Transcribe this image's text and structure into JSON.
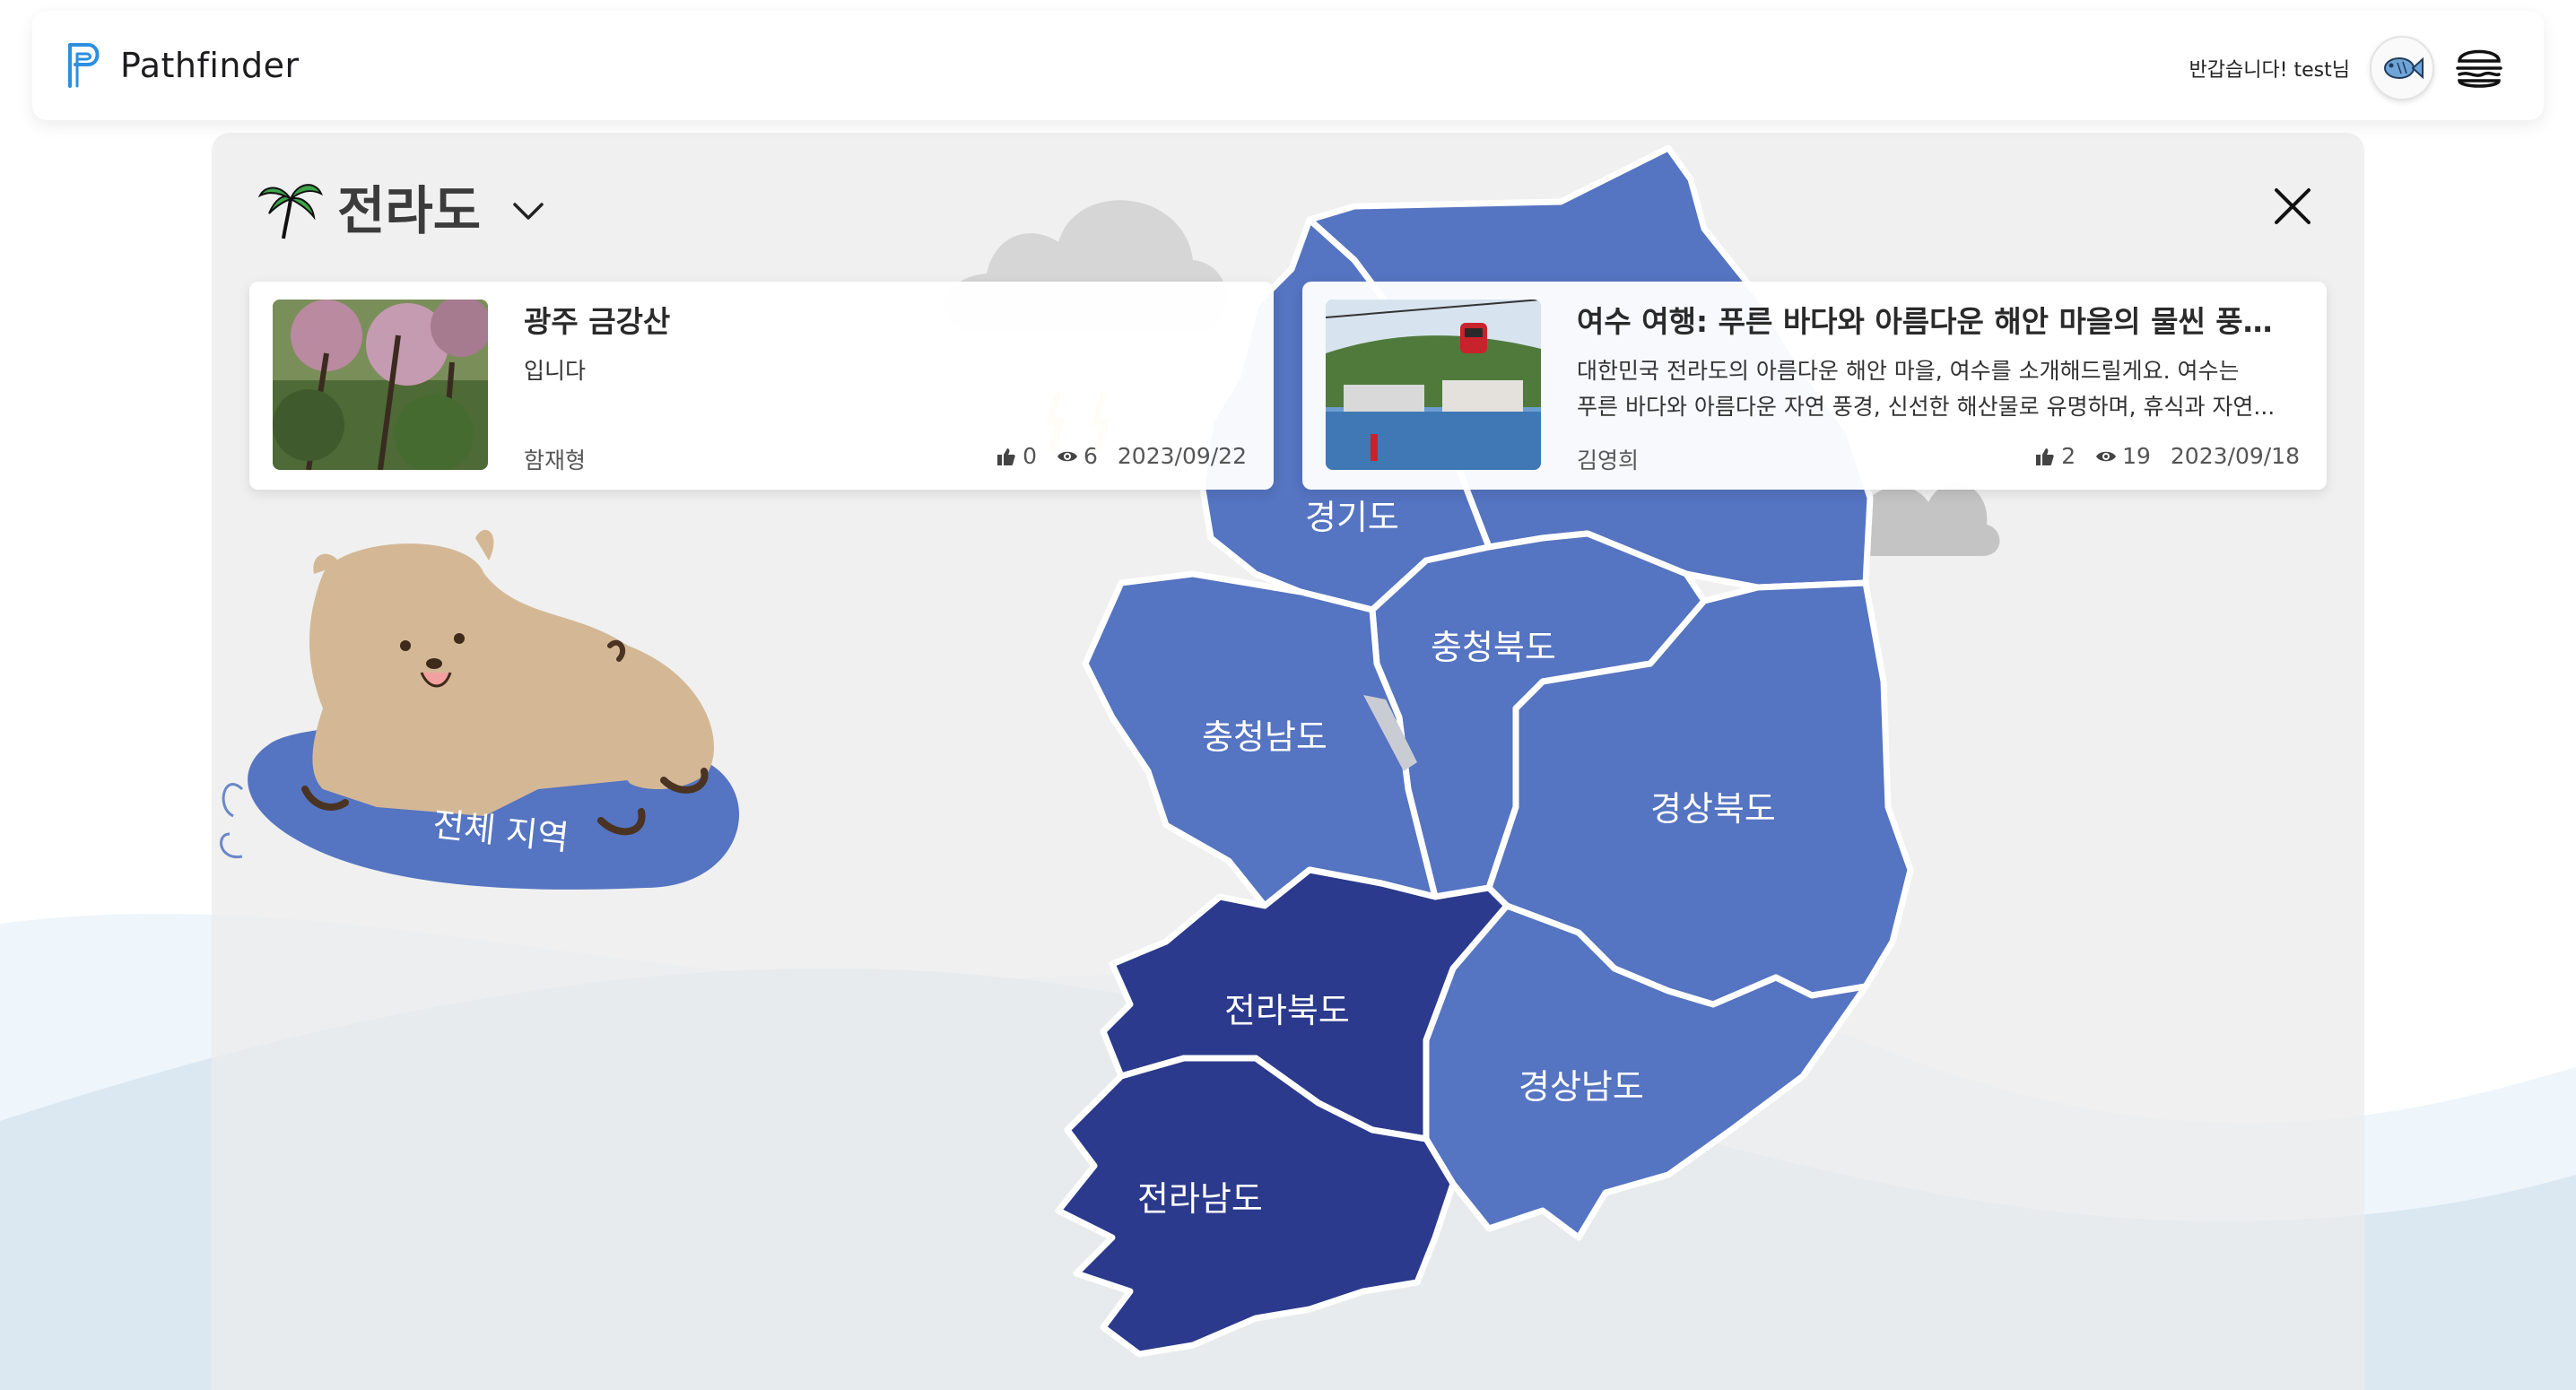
{
  "header": {
    "app_name": "Pathfinder",
    "greeting": "반갑습니다! test님",
    "avatar_icon": "fish-icon",
    "menu_icon": "burger-menu-icon"
  },
  "region_selector": {
    "title": "전라도",
    "icon": "palm-tree-icon",
    "dropdown_icon": "chevron-down-icon",
    "close_icon": "close-icon"
  },
  "posts": [
    {
      "title": "광주 금강산",
      "body_lines": [
        "입니다"
      ],
      "author": "함재형",
      "likes": "0",
      "views": "6",
      "date": "2023/09/22"
    },
    {
      "title": "여수 여행: 푸른 바다와 아름다운 해안 마을의 물씬 풍기...",
      "body_lines": [
        "대한민국 전라도의 아름다운 해안 마을, 여수를 소개해드릴게요. 여수는",
        "푸른 바다와 아름다운 자연 풍경, 신선한 해산물로 유명하며, 휴식과 자연..."
      ],
      "author": "김영희",
      "likes": "2",
      "views": "19",
      "date": "2023/09/18"
    }
  ],
  "all_regions_label": "전체 지역",
  "map": {
    "selected_region": "전라도",
    "highlight_color": "#2b3a8c",
    "region_color": "#5574c1",
    "regions": {
      "gyeonggi": "경기도",
      "chungbuk": "충청북도",
      "chungnam": "충청남도",
      "gyeongbuk": "경상북도",
      "jeonbuk": "전라북도",
      "gyeongnam": "경상남도",
      "jeonnam": "전라남도"
    }
  }
}
